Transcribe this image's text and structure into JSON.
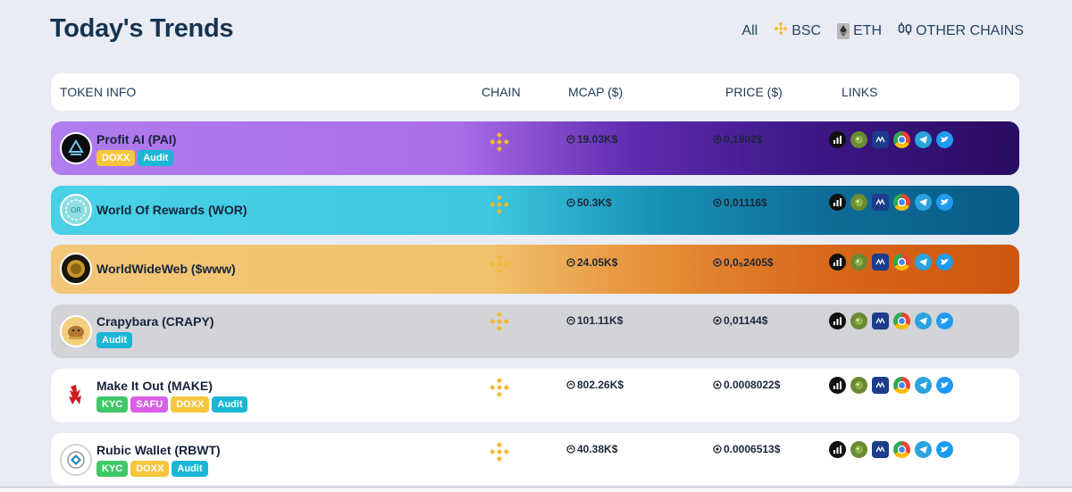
{
  "title": "Today's Trends",
  "filters": [
    "All",
    "BSC",
    "ETH",
    "OTHER CHAINS"
  ],
  "columns": {
    "token_info": "TOKEN INFO",
    "chain": "CHAIN",
    "mcap": "MCAP ($)",
    "price": "PRICE ($)",
    "links": "LINKS"
  },
  "tokens": [
    {
      "name": "Profit AI (PAI)",
      "badges": [
        "DOXX",
        "Audit"
      ],
      "mcap": "19.03K$",
      "price": "0,1902$"
    },
    {
      "name": "World Of Rewards (WOR)",
      "badges": [],
      "mcap": "50.3K$",
      "price": "0,01116$"
    },
    {
      "name": "WorldWideWeb ($www)",
      "badges": [],
      "mcap": "24.05K$",
      "price": "0,0₅2405$"
    },
    {
      "name": "Crapybara (CRAPY)",
      "badges": [
        "Audit"
      ],
      "mcap": "101.11K$",
      "price": "0,01144$"
    },
    {
      "name": "Make It Out (MAKE)",
      "badges": [
        "KYC",
        "SAFU",
        "DOXX",
        "Audit"
      ],
      "mcap": "802.26K$",
      "price": "0.0008022$"
    },
    {
      "name": "Rubic Wallet (RBWT)",
      "badges": [
        "KYC",
        "DOXX",
        "Audit"
      ],
      "mcap": "40.38K$",
      "price": "0.0006513$"
    }
  ],
  "colors": {
    "row_backgrounds": [
      "purple-gradient",
      "cyan-gradient",
      "orange-gradient",
      "grey",
      "white",
      "white"
    ],
    "bsc": "#f3ba2f",
    "doxx": "#f5c63e",
    "audit": "#1bb6d6",
    "kyc": "#3fc867",
    "safu": "#d95fe6"
  },
  "icons": {
    "chain": "bsc-icon",
    "links": [
      "dextools-icon",
      "coingecko-icon",
      "coinmarketcap-icon",
      "website-icon",
      "telegram-icon",
      "twitter-icon"
    ]
  }
}
